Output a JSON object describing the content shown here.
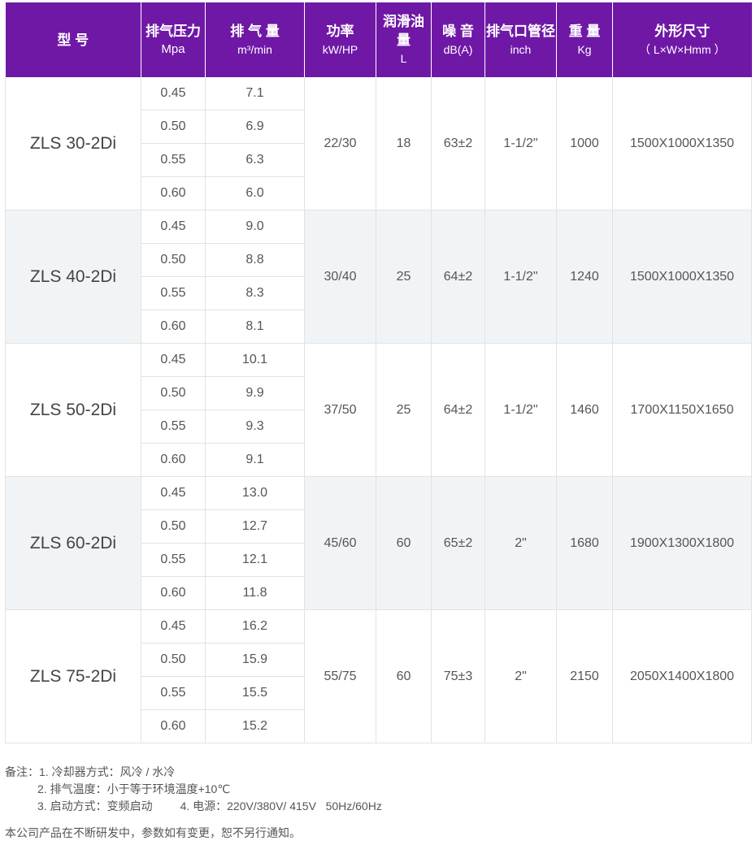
{
  "header": {
    "model": "型 号",
    "pressure": {
      "title": "排气压力",
      "unit": "Mpa"
    },
    "flow": {
      "title": "排 气 量",
      "unit": "m³/min"
    },
    "power": {
      "title": "功率",
      "unit": "kW/HP"
    },
    "oil": {
      "title": "润滑油量",
      "unit": "L"
    },
    "noise": {
      "title": "噪 音",
      "unit": "dB(A)"
    },
    "outlet": {
      "title": "排气口管径",
      "unit": "inch"
    },
    "weight": {
      "title": "重 量",
      "unit": "Kg"
    },
    "size": {
      "title": "外形尺寸",
      "unit": "（ L×W×Hmm ）"
    }
  },
  "groups": [
    {
      "model": "ZLS 30-2Di",
      "power": "22/30",
      "oil": "18",
      "noise": "63±2",
      "outlet": "1-1/2\"",
      "weight": "1000",
      "size": "1500X1000X1350",
      "rows": [
        {
          "pressure": "0.45",
          "flow": "7.1"
        },
        {
          "pressure": "0.50",
          "flow": "6.9"
        },
        {
          "pressure": "0.55",
          "flow": "6.3"
        },
        {
          "pressure": "0.60",
          "flow": "6.0"
        }
      ]
    },
    {
      "model": "ZLS 40-2Di",
      "power": "30/40",
      "oil": "25",
      "noise": "64±2",
      "outlet": "1-1/2\"",
      "weight": "1240",
      "size": "1500X1000X1350",
      "rows": [
        {
          "pressure": "0.45",
          "flow": "9.0"
        },
        {
          "pressure": "0.50",
          "flow": "8.8"
        },
        {
          "pressure": "0.55",
          "flow": "8.3"
        },
        {
          "pressure": "0.60",
          "flow": "8.1"
        }
      ]
    },
    {
      "model": "ZLS 50-2Di",
      "power": "37/50",
      "oil": "25",
      "noise": "64±2",
      "outlet": "1-1/2\"",
      "weight": "1460",
      "size": "1700X1150X1650",
      "rows": [
        {
          "pressure": "0.45",
          "flow": "10.1"
        },
        {
          "pressure": "0.50",
          "flow": "9.9"
        },
        {
          "pressure": "0.55",
          "flow": "9.3"
        },
        {
          "pressure": "0.60",
          "flow": "9.1"
        }
      ]
    },
    {
      "model": "ZLS 60-2Di",
      "power": "45/60",
      "oil": "60",
      "noise": "65±2",
      "outlet": "2\"",
      "weight": "1680",
      "size": "1900X1300X1800",
      "rows": [
        {
          "pressure": "0.45",
          "flow": "13.0"
        },
        {
          "pressure": "0.50",
          "flow": "12.7"
        },
        {
          "pressure": "0.55",
          "flow": "12.1"
        },
        {
          "pressure": "0.60",
          "flow": "11.8"
        }
      ]
    },
    {
      "model": "ZLS 75-2Di",
      "power": "55/75",
      "oil": "60",
      "noise": "75±3",
      "outlet": "2\"",
      "weight": "2150",
      "size": "2050X1400X1800",
      "rows": [
        {
          "pressure": "0.45",
          "flow": "16.2"
        },
        {
          "pressure": "0.50",
          "flow": "15.9"
        },
        {
          "pressure": "0.55",
          "flow": "15.5"
        },
        {
          "pressure": "0.60",
          "flow": "15.2"
        }
      ]
    }
  ],
  "notes": {
    "line1": "备注：1. 冷却器方式：风冷 / 水冷",
    "line2": "2. 排气温度：小于等于环境温度+10℃",
    "line3a": "3. 启动方式：变频启动",
    "line3b": "4. 电源：220V/380V/ 415V   50Hz/60Hz"
  },
  "footer": "本公司产品在不断研发中，参数如有变更，恕不另行通知。",
  "colors": {
    "header_bg": "#6f18a6",
    "alt_row_bg": "#f1f4f6",
    "border": "#e2e2e2"
  }
}
